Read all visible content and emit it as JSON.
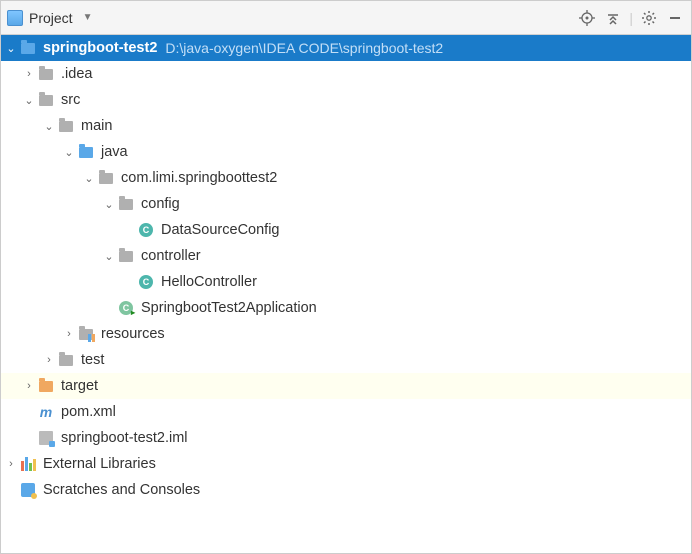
{
  "toolbar": {
    "title": "Project"
  },
  "root": {
    "name": "springboot-test2",
    "path": "D:\\java-oxygen\\IDEA CODE\\springboot-test2"
  },
  "nodes": {
    "idea": ".idea",
    "src": "src",
    "main": "main",
    "java": "java",
    "package": "com.limi.springboottest2",
    "config": "config",
    "dataSourceConfig": "DataSourceConfig",
    "controller": "controller",
    "helloController": "HelloController",
    "app": "SpringbootTest2Application",
    "resources": "resources",
    "test": "test",
    "target": "target",
    "pom": "pom.xml",
    "iml": "springboot-test2.iml",
    "extLib": "External Libraries",
    "scratches": "Scratches and Consoles"
  },
  "classIconLetter": "C",
  "mavenIconLetter": "m"
}
